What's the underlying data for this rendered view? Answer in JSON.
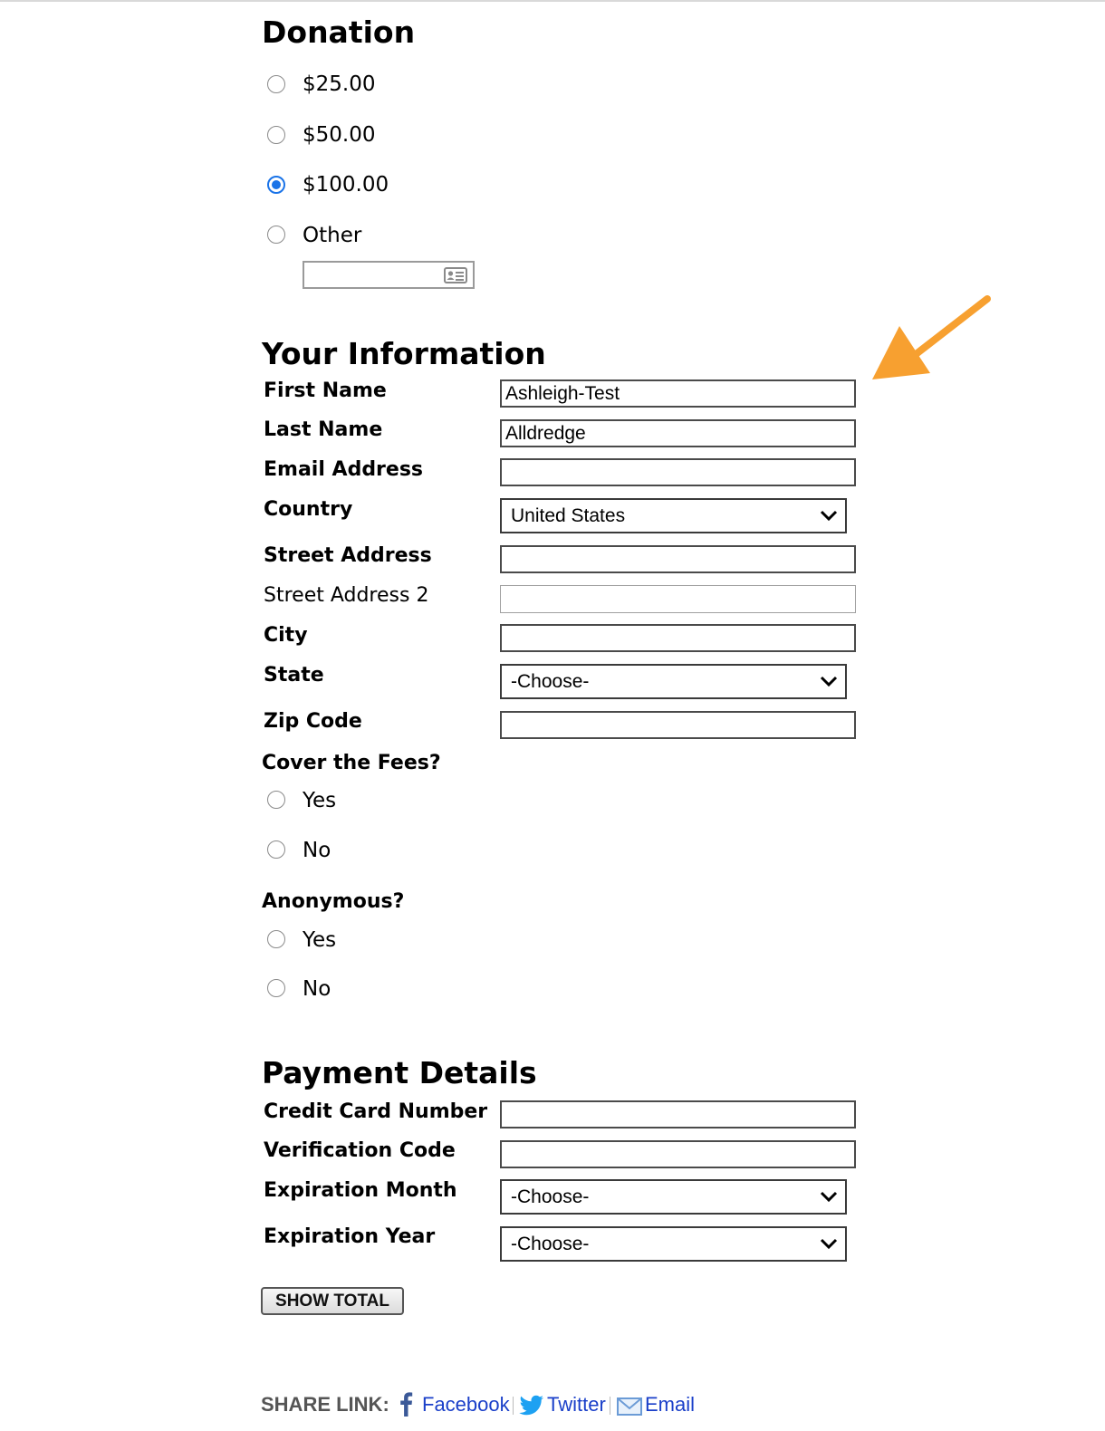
{
  "donation": {
    "title": "Donation",
    "options": [
      "$25.00",
      "$50.00",
      "$100.00",
      "Other"
    ],
    "selected": "$100.00",
    "other_value": ""
  },
  "info": {
    "title": "Your Information",
    "fields": {
      "first_name": {
        "label": "First Name",
        "value": "Ashleigh-Test"
      },
      "last_name": {
        "label": "Last Name",
        "value": "Alldredge"
      },
      "email": {
        "label": "Email Address",
        "value": ""
      },
      "country": {
        "label": "Country",
        "value": "United States"
      },
      "street": {
        "label": "Street Address",
        "value": ""
      },
      "street2": {
        "label": "Street Address 2",
        "value": ""
      },
      "city": {
        "label": "City",
        "value": ""
      },
      "state": {
        "label": "State",
        "value": "-Choose-"
      },
      "zip": {
        "label": "Zip Code",
        "value": ""
      }
    },
    "cover_fees": {
      "question": "Cover the Fees?",
      "options": [
        "Yes",
        "No"
      ]
    },
    "anonymous": {
      "question": "Anonymous?",
      "options": [
        "Yes",
        "No"
      ]
    }
  },
  "payment": {
    "title": "Payment Details",
    "fields": {
      "card_number": {
        "label": "Credit Card Number",
        "value": ""
      },
      "verification": {
        "label": "Verification Code",
        "value": ""
      },
      "exp_month": {
        "label": "Expiration Month",
        "value": "-Choose-"
      },
      "exp_year": {
        "label": "Expiration Year",
        "value": "-Choose-"
      }
    },
    "show_total_label": "SHOW TOTAL"
  },
  "share": {
    "label": "SHARE LINK:",
    "facebook": "Facebook",
    "twitter": "Twitter",
    "email": "Email"
  },
  "colors": {
    "accent": "#1a73e8",
    "arrow": "#f7a030",
    "link": "#1a3fc9"
  },
  "icons": [
    "contact-card-icon",
    "chevron-down-icon",
    "arrow-annotation-icon",
    "facebook-icon",
    "twitter-icon",
    "email-icon"
  ]
}
